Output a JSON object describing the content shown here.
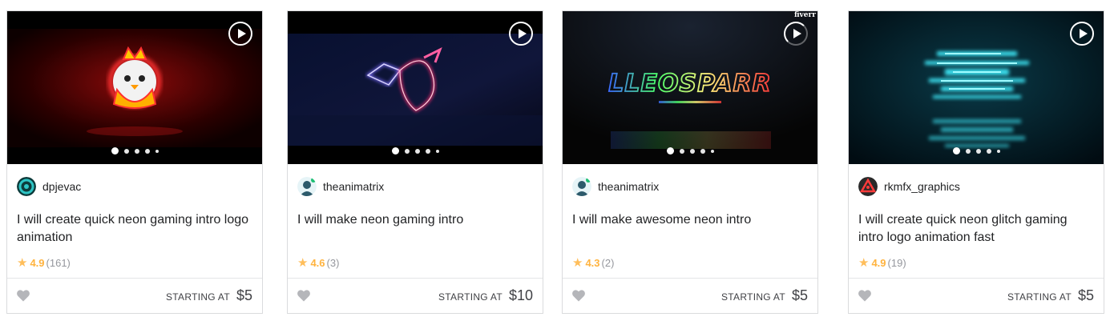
{
  "gigs": [
    {
      "seller": "dpjevac",
      "title": "I will create quick neon gaming intro logo animation",
      "rating": "4.9",
      "reviews": "(161)",
      "starting_label": "STARTING AT",
      "price": "$5",
      "thumbnail_bg": "#2a0000"
    },
    {
      "seller": "theanimatrix",
      "title": "I will make neon gaming intro",
      "rating": "4.6",
      "reviews": "(3)",
      "starting_label": "STARTING AT",
      "price": "$10",
      "thumbnail_bg": "#0a0f2a"
    },
    {
      "seller": "theanimatrix",
      "title": "I will make awesome neon intro",
      "rating": "4.3",
      "reviews": "(2)",
      "starting_label": "STARTING AT",
      "price": "$5",
      "thumbnail_bg": "#050505",
      "thumbnail_text": "LLEOSPARR",
      "watermark": "fiverr"
    },
    {
      "seller": "rkmfx_graphics",
      "title": "I will create quick neon glitch gaming intro logo animation fast",
      "rating": "4.9",
      "reviews": "(19)",
      "starting_label": "STARTING AT",
      "price": "$5",
      "thumbnail_bg": "#02141c"
    }
  ],
  "icons": {
    "play": "play-icon",
    "star": "star-icon",
    "heart": "heart-icon"
  },
  "colors": {
    "star": "#ffbe5b",
    "rating": "#ffb33e",
    "heart": "#b5b6ba"
  }
}
